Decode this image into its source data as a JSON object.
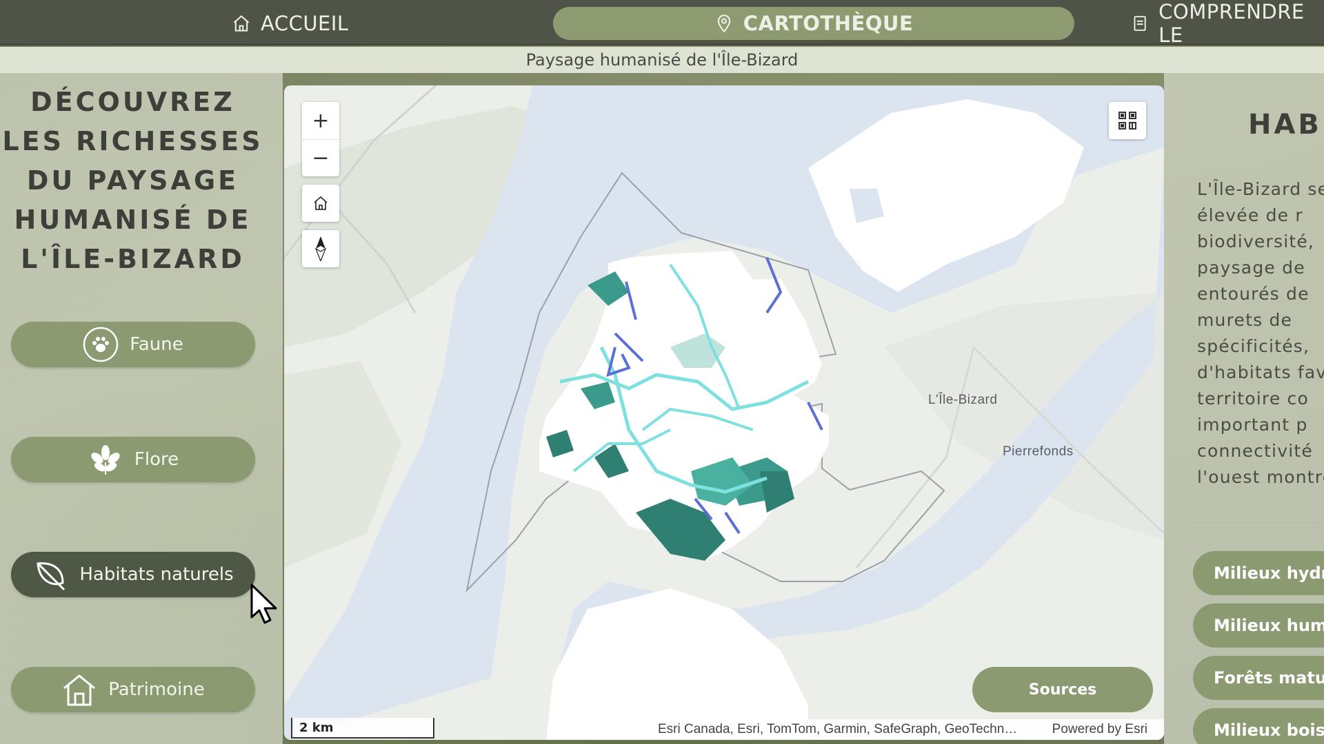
{
  "nav": {
    "home_label": "ACCUEIL",
    "map_label": "CARTOTHÈQUE",
    "understand_label": "COMPRENDRE LE"
  },
  "subtitle": "Paysage humanisé de l'Île-Bizard",
  "left": {
    "title_lines": [
      "DÉCOUVREZ",
      "LES RICHESSES",
      "DU PAYSAGE",
      "HUMANISÉ DE",
      "L'ÎLE-BIZARD"
    ],
    "buttons": [
      {
        "label": "Faune",
        "icon": "paw-icon"
      },
      {
        "label": "Flore",
        "icon": "flower-icon"
      },
      {
        "label": "Habitats naturels",
        "icon": "leaf-icon",
        "active": true
      },
      {
        "label": "Patrimoine",
        "icon": "house-icon"
      }
    ]
  },
  "map": {
    "zoom_in": "+",
    "zoom_out": "−",
    "places": [
      "L'Île-Bizard",
      "Pierrefonds"
    ],
    "sources_label": "Sources",
    "scale_label": "2 km",
    "attribution": "Esri Canada, Esri, TomTom, Garmin, SafeGraph, GeoTechn…",
    "powered_by": "Powered by Esri"
  },
  "right": {
    "title": "HABIT",
    "text_lines": [
      "L'Île-Bizard se",
      "élevée de r",
      "biodiversité,",
      "paysage de",
      "entourés de",
      "murets de",
      "spécificités,",
      "d'habitats fav",
      "territoire co",
      "important p",
      "connectivité",
      "l'ouest montre"
    ],
    "buttons": [
      "Milieux hydriq",
      "Milieux humid",
      "Forêts mature",
      "Milieux boisé"
    ]
  },
  "colors": {
    "nav_bg": "#4f5348",
    "accent_green": "#8c9a72",
    "active_green": "#4e5844",
    "water": "#dbe4ef",
    "habitat_teal": "#3a9a8c",
    "habitat_cyan": "#7fe0e0",
    "habitat_blue": "#5b6fd6"
  }
}
